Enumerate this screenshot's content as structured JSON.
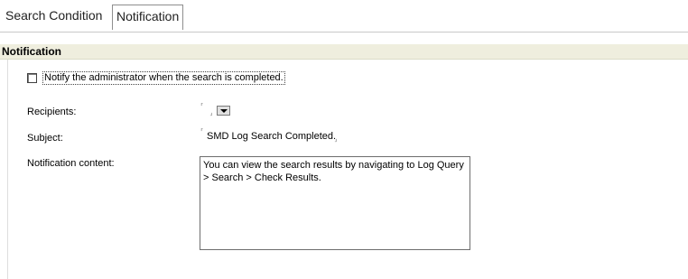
{
  "tabs": [
    {
      "label": "Search Condition",
      "active": false
    },
    {
      "label": "Notification",
      "active": true
    }
  ],
  "section": {
    "title": "Notification"
  },
  "notify_checkbox": {
    "label": "Notify the administrator when the search is completed.",
    "checked": false
  },
  "fields": {
    "recipients": {
      "label": "Recipients:",
      "value": ""
    },
    "subject": {
      "label": "Subject:",
      "value": "SMD Log Search Completed."
    },
    "content": {
      "label": "Notification content:",
      "value": "You can view the search results by navigating to Log Query\n> Search > Check Results."
    }
  },
  "icons": {
    "dropdown": "chevron-down-icon",
    "field_bracket_open": "⸢",
    "field_bracket_close": "⸥"
  },
  "colors": {
    "section_bg": "#efeede",
    "tab_border": "#8e8e8e"
  }
}
